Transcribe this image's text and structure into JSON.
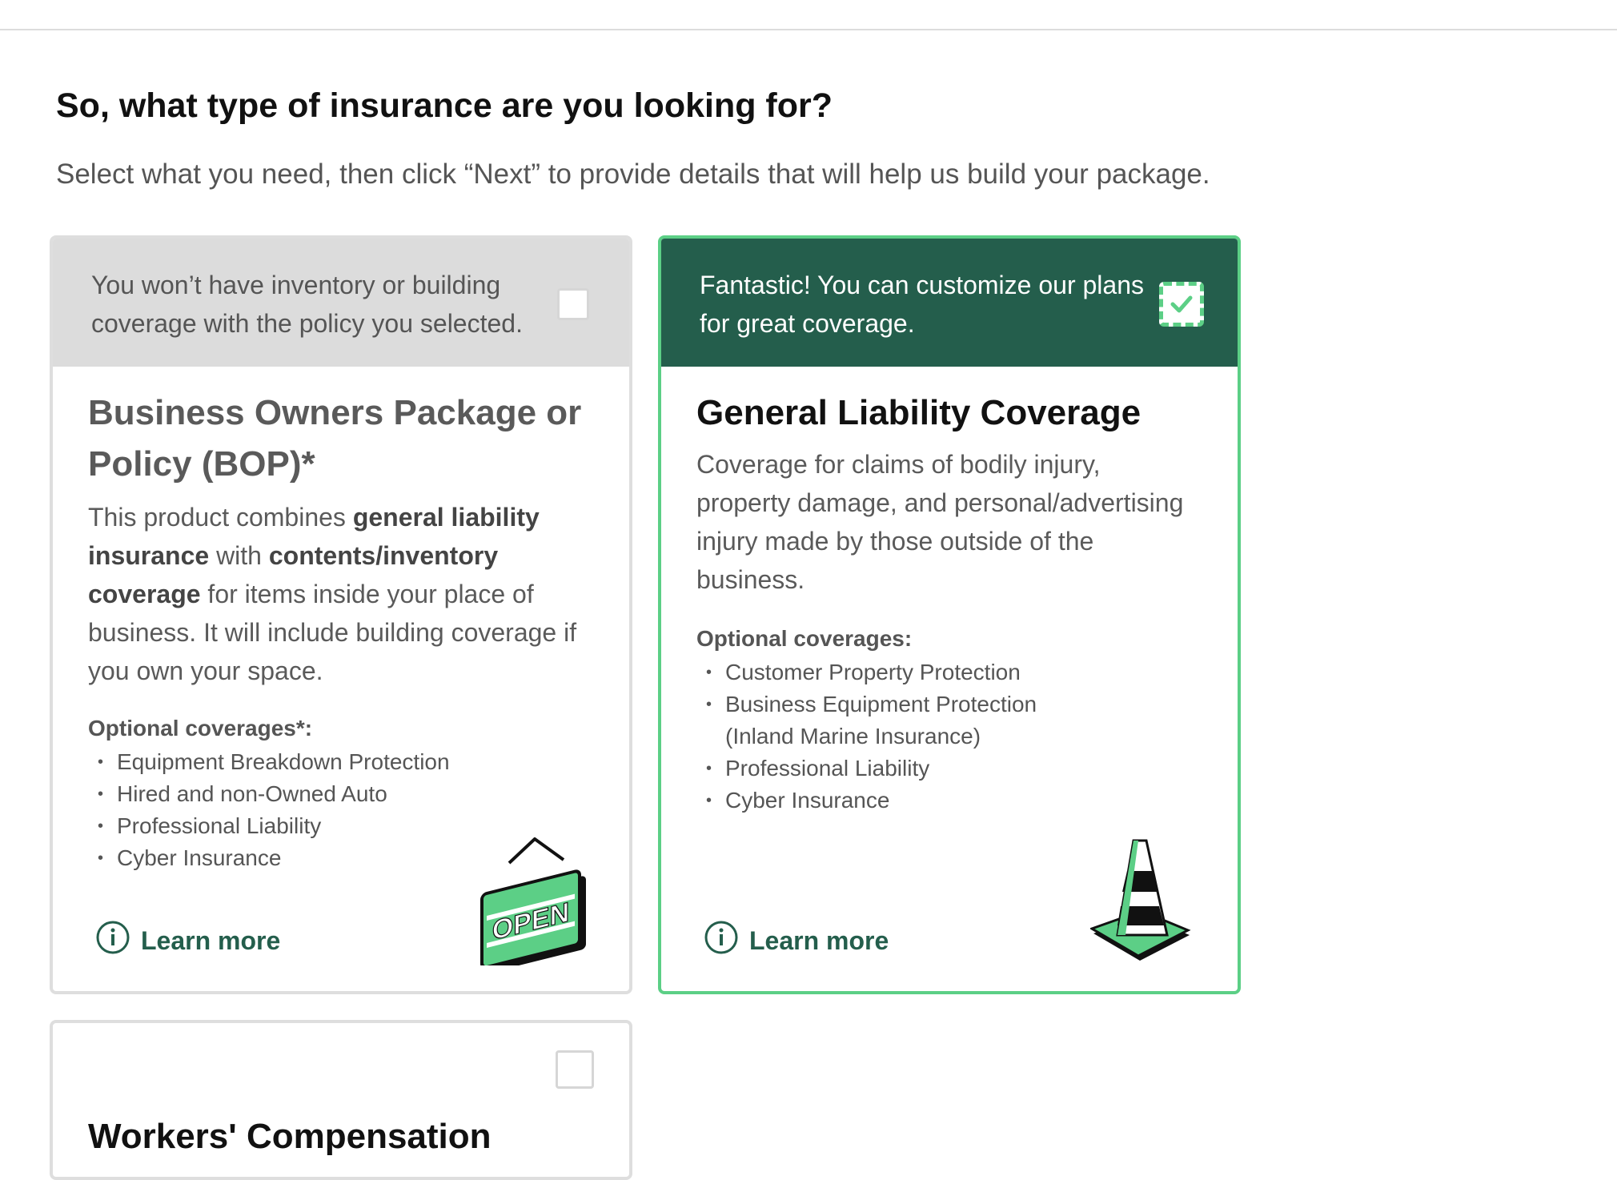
{
  "page": {
    "heading": "So, what type of insurance are you looking for?",
    "subheading": "Select what you need, then click “Next” to provide details that will help us build your package."
  },
  "cards": {
    "bop": {
      "banner": "You won’t have inventory or building coverage with the policy you selected.",
      "selected": false,
      "title": "Business Owners Package or Policy (BOP)*",
      "desc": {
        "p1": "This product combines ",
        "b1": "general liability insurance",
        "p2": " with ",
        "b2": "contents/inventory coverage",
        "p3": " for items inside your place of business. It will include building coverage if you own your space."
      },
      "optional_label": "Optional coverages*:",
      "optional": [
        "Equipment Breakdown Protection",
        "Hired and non-Owned Auto",
        "Professional Liability",
        "Cyber Insurance"
      ],
      "learn_more": "Learn more",
      "illustration": "open-sign-icon",
      "sign_text": "OPEN"
    },
    "gl": {
      "banner": "Fantastic! You can customize our plans for great coverage.",
      "selected": true,
      "title": "General Liability Coverage",
      "desc": "Coverage for claims of bodily injury, property damage, and personal/advertising injury made by those outside of the business.",
      "optional_label": "Optional coverages:",
      "optional": [
        "Customer Property Protection",
        "Business Equipment Protection (Inland Marine Insurance)",
        "Professional Liability",
        "Cyber Insurance"
      ],
      "learn_more": "Learn more",
      "illustration": "traffic-cone-icon"
    },
    "wc": {
      "selected": false,
      "title_partial": "Workers' Compensation"
    }
  },
  "colors": {
    "accent": "#5ccf86",
    "dark_green": "#245e4c",
    "disabled_banner": "#dcdcdc"
  }
}
